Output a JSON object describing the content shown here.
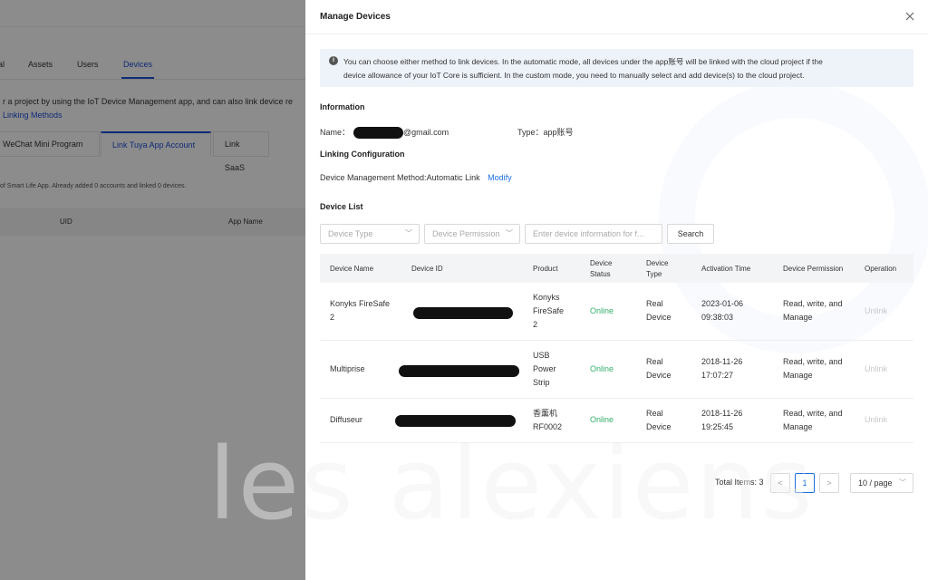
{
  "background": {
    "tabs": [
      "al",
      "Assets",
      "Users",
      "Devices"
    ],
    "description": "r a project by using the IoT Device Management app, and can also link device re",
    "link": "Linking Methods",
    "subtabs": [
      "WeChat Mini Program",
      "Link Tuya App Account",
      "Link SaaS"
    ],
    "note": "of Smart Life App. Already added 0 accounts and linked 0 devices.",
    "table_headers": [
      "UID",
      "App Name"
    ]
  },
  "drawer": {
    "title": "Manage Devices",
    "alert_line1": "You can choose either method to link devices. In the automatic mode, all devices under the app账号 will be linked with the cloud project if the",
    "alert_line2": "device allowance of your IoT Core is sufficient. In the custom mode, you need to manually select and add device(s) to the cloud project.",
    "information_title": "Information",
    "name_label": "Name：",
    "name_suffix": "@gmail.com",
    "type_label": "Type：",
    "type_value": "app账号",
    "linking_title": "Linking Configuration",
    "method_label": "Device Management Method:",
    "method_value": "Automatic Link",
    "modify": "Modify",
    "device_list_title": "Device List",
    "filters": {
      "device_type": "Device Type",
      "device_permission": "Device Permission",
      "search_placeholder": "Enter device information for f...",
      "search_button": "Search"
    },
    "columns": {
      "name": "Device Name",
      "id": "Device ID",
      "product": "Product",
      "status_1": "Device",
      "status_2": "Status",
      "type_1": "Device",
      "type_2": "Type",
      "activation": "Activation Time",
      "permission": "Device Permission",
      "operation": "Operation"
    },
    "rows": [
      {
        "name_1": "Konyks FireSafe",
        "name_2": "2",
        "product_1": "Konyks",
        "product_2": "FireSafe",
        "product_3": "2",
        "status": "Online",
        "type_1": "Real",
        "type_2": "Device",
        "time_1": "2023-01-06",
        "time_2": "09:38:03",
        "perm_1": "Read, write, and",
        "perm_2": "Manage",
        "op": "Unlink"
      },
      {
        "name_1": "Multiprise",
        "name_2": "",
        "product_1": "USB",
        "product_2": "Power",
        "product_3": "Strip",
        "status": "Online",
        "type_1": "Real",
        "type_2": "Device",
        "time_1": "2018-11-26",
        "time_2": "17:07:27",
        "perm_1": "Read, write, and",
        "perm_2": "Manage",
        "op": "Unlink"
      },
      {
        "name_1": "Diffuseur",
        "name_2": "",
        "product_1": "香薰机",
        "product_2": "RF0002",
        "product_3": "",
        "status": "Online",
        "type_1": "Real",
        "type_2": "Device",
        "time_1": "2018-11-26",
        "time_2": "19:25:45",
        "perm_1": "Read, write, and",
        "perm_2": "Manage",
        "op": "Unlink"
      }
    ],
    "pagination": {
      "total": "Total Items: 3",
      "prev": "<",
      "page": "1",
      "next": ">",
      "page_size": "10 / page"
    }
  },
  "watermark": "les alexiens"
}
